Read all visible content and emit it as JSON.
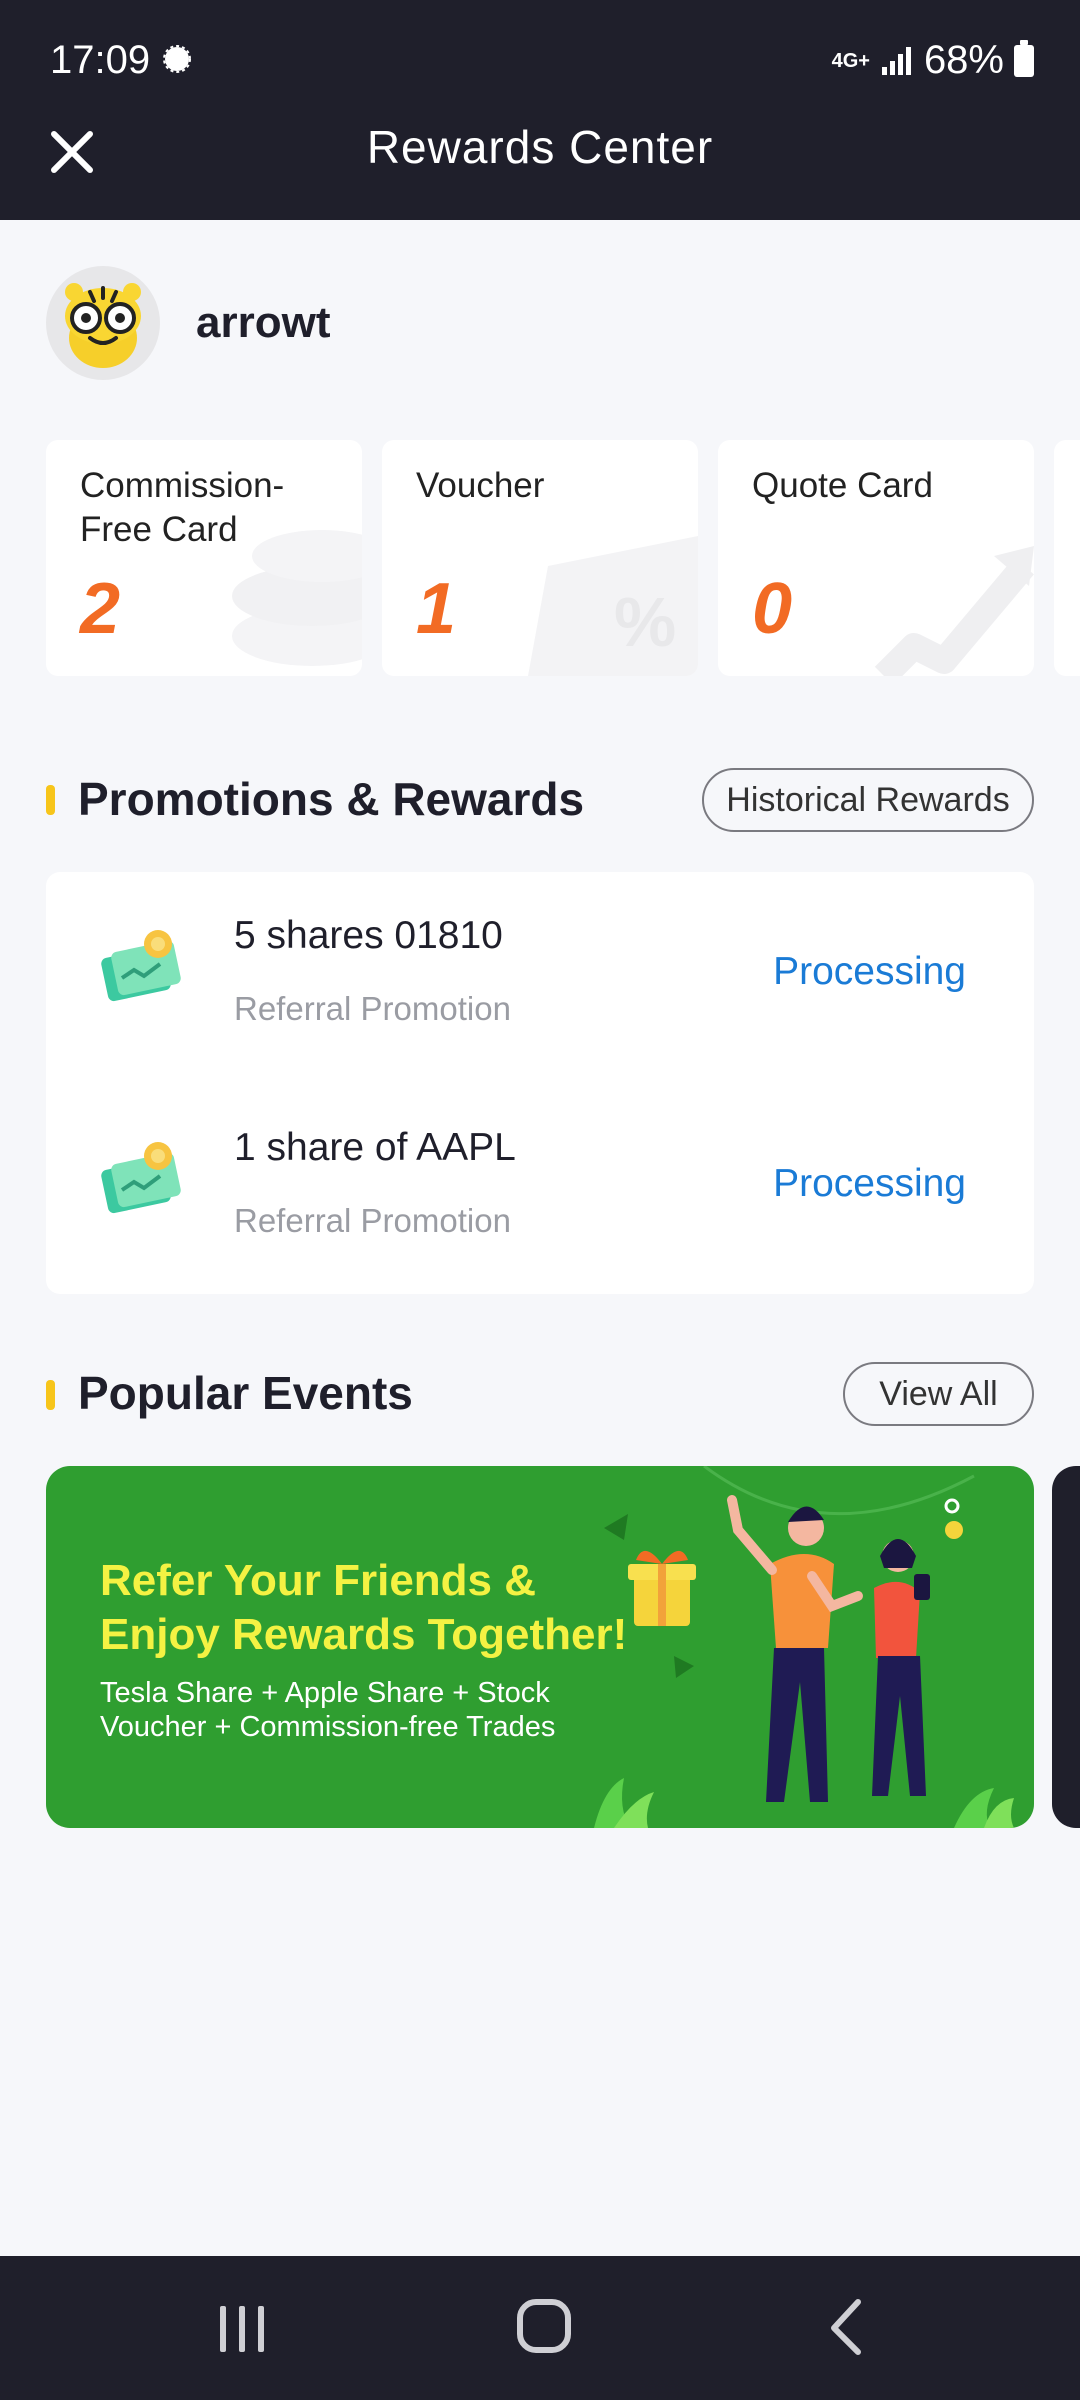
{
  "status_bar": {
    "time": "17:09",
    "network": "4G+",
    "battery": "68%"
  },
  "header": {
    "title": "Rewards Center"
  },
  "profile": {
    "username": "arrowt"
  },
  "cards": [
    {
      "label": "Commission-Free Card",
      "value": "2"
    },
    {
      "label": "Voucher",
      "value": "1"
    },
    {
      "label": "Quote Card",
      "value": "0"
    }
  ],
  "promotions": {
    "title": "Promotions & Rewards",
    "history_button": "Historical Rewards",
    "items": [
      {
        "title": "5 shares 01810",
        "subtitle": "Referral Promotion",
        "status": "Processing"
      },
      {
        "title": "1 share of AAPL",
        "subtitle": "Referral Promotion",
        "status": "Processing"
      }
    ]
  },
  "events": {
    "title": "Popular Events",
    "view_all": "View All",
    "banner": {
      "title": "Refer Your Friends & Enjoy Rewards Together!",
      "subtitle": "Tesla Share + Apple Share + Stock Voucher + Commission-free Trades"
    }
  },
  "colors": {
    "header_bg": "#1f1f2b",
    "accent_orange": "#f26b24",
    "status_blue": "#1a7bd6",
    "section_marker": "#f7c51a",
    "banner_green": "#2f9e30",
    "banner_title": "#f4f243"
  },
  "icons": {
    "close": "close-icon",
    "reward": "reward-ticket-icon",
    "nav_recent": "recent-apps-icon",
    "nav_home": "home-icon",
    "nav_back": "back-icon"
  }
}
